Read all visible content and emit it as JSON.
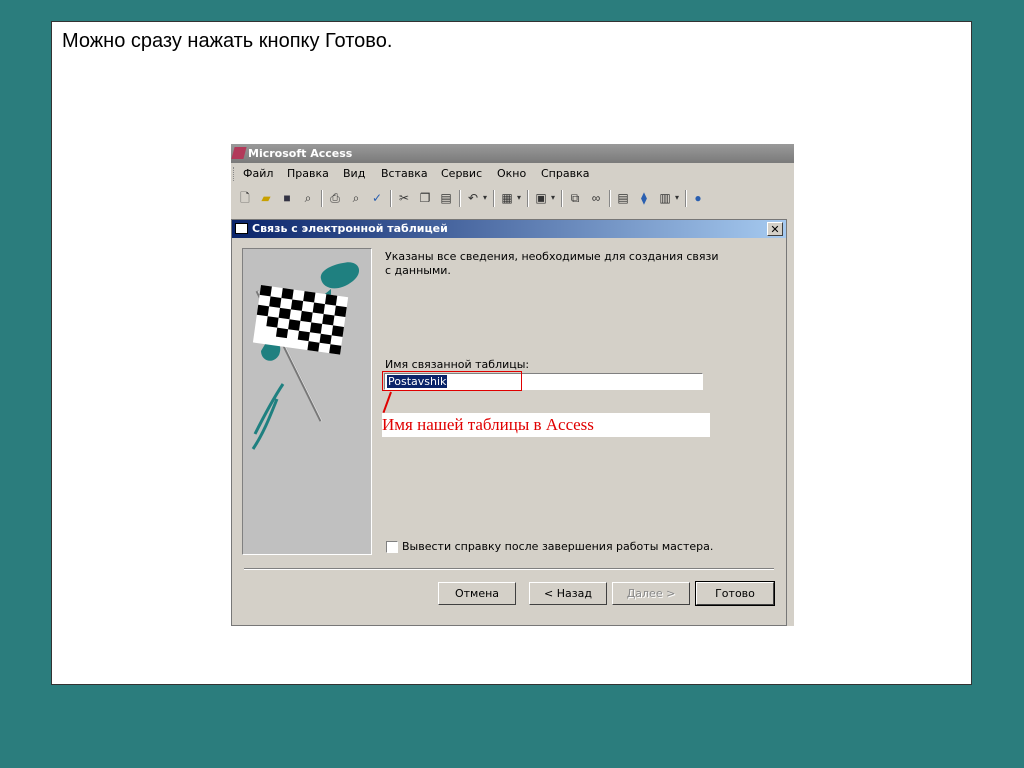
{
  "slide": {
    "text": "Можно сразу нажать кнопку Готово."
  },
  "app": {
    "title": "Microsoft Access"
  },
  "menu": {
    "items": [
      "Файл",
      "Правка",
      "Вид",
      "Вставка",
      "Сервис",
      "Окно",
      "Справка"
    ]
  },
  "toolbar": {
    "icons": [
      "new-icon",
      "open-icon",
      "save-icon",
      "search-icon",
      "print-icon",
      "preview-icon",
      "spell-icon",
      "cut-icon",
      "copy-icon",
      "paste-icon",
      "undo-icon",
      "analyze-icon",
      "office-links-icon",
      "relationships-icon",
      "link-icon",
      "properties-icon",
      "relationship-icon",
      "new-object-icon",
      "help-icon"
    ]
  },
  "dialog": {
    "title": "Связь с электронной таблицей",
    "close_glyph": "✕",
    "info": "Указаны все сведения, необходимые для создания связи с данными.",
    "table_name_label": "Имя связанной таблицы:",
    "table_name_value": "Postavshik",
    "checkbox_label": "Вывести справку после завершения работы мастера.",
    "checkbox_checked": false,
    "buttons": {
      "cancel": "Отмена",
      "back": "< Назад",
      "next": "Далее >",
      "finish": "Готово"
    }
  },
  "annotation": {
    "text": "Имя нашей таблицы в Access",
    "color": "#e00000"
  },
  "colors": {
    "background": "#2b7d7d",
    "dialog_title": "#0a246a"
  }
}
